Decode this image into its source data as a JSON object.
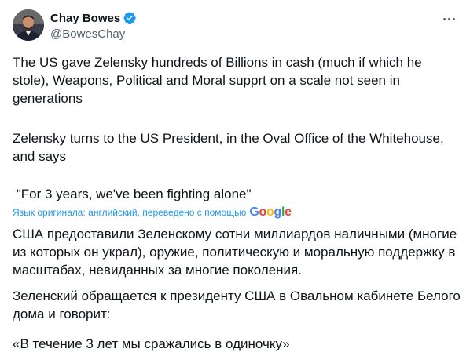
{
  "author": {
    "display_name": "Chay Bowes",
    "handle": "@BowesChay",
    "verified": true,
    "verified_color": "#1d9bf0",
    "avatar_icon": "user-avatar"
  },
  "post": {
    "original": [
      "The US gave Zelensky hundreds of Billions in cash (much if which he stole), Weapons, Political and Moral supprt on a scale not seen in generations",
      "Zelensky turns to the US President, in the Oval Office of the Whitehouse, and says",
      " \"For 3 years, we've been fighting alone\""
    ],
    "translation_note": "Язык оригинала: английский, переведено с помощью",
    "translation_provider": "Google",
    "translated": [
      "США предоставили Зеленскому сотни миллиардов наличными (многие из которых он украл), оружие, политическую и моральную поддержку в масштабах, невиданных за многие поколения.",
      "Зеленский обращается к президенту США в Овальном кабинете Белого дома и говорит:",
      "«В течение 3 лет мы сражались в одиночку»"
    ]
  },
  "colors": {
    "text": "#0f1419",
    "secondary": "#536471",
    "link": "#1d9bf0"
  }
}
